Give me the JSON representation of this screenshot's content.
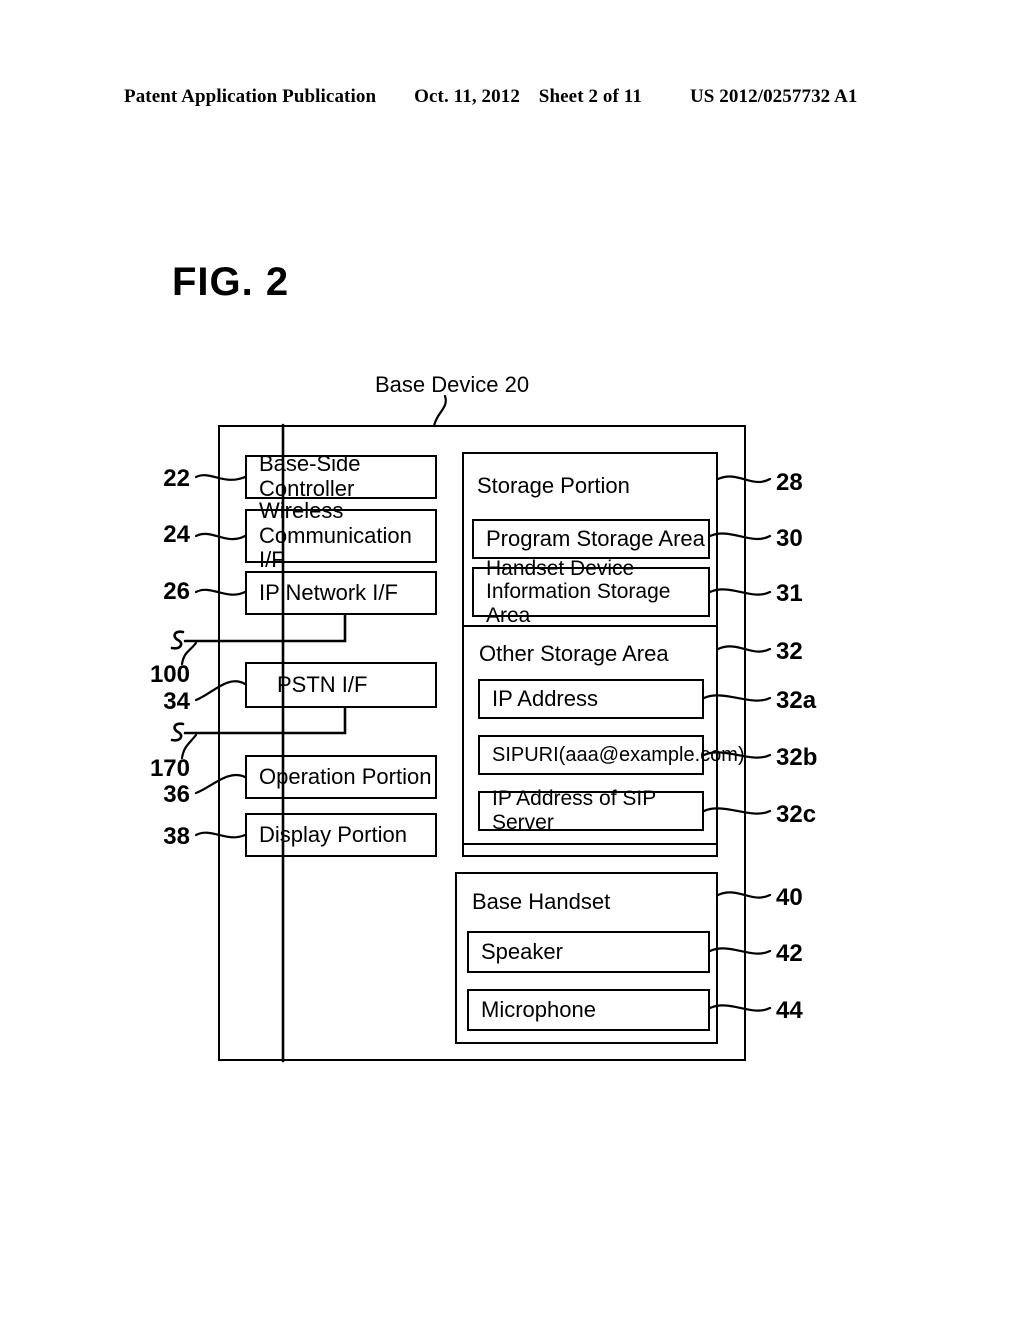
{
  "header": {
    "publication": "Patent Application Publication",
    "date": "Oct. 11, 2012",
    "sheet": "Sheet 2 of 11",
    "patent_number": "US 2012/0257732 A1"
  },
  "figure": {
    "title": "FIG. 2",
    "device_label": "Base Device 20"
  },
  "left_column": {
    "blocks": [
      {
        "ref": "22",
        "label": "Base-Side Controller"
      },
      {
        "ref": "24",
        "label": "Wireless\nCommunication I/F"
      },
      {
        "ref": "26",
        "label": "IP Network I/F"
      },
      {
        "ref": "34",
        "label": "PSTN  I/F"
      },
      {
        "ref": "36",
        "label": "Operation Portion"
      },
      {
        "ref": "38",
        "label": "Display Portion"
      }
    ],
    "external_lines": [
      {
        "ref": "100"
      },
      {
        "ref": "170"
      }
    ]
  },
  "right_column": {
    "storage_portion": {
      "ref": "28",
      "title": "Storage Portion",
      "areas": [
        {
          "ref": "30",
          "label": "Program Storage Area"
        },
        {
          "ref": "31",
          "label": "Handset Device\nInformation Storage Area"
        }
      ],
      "other_storage_area": {
        "ref": "32",
        "title": "Other Storage Area",
        "items": [
          {
            "ref": "32a",
            "label": "IP Address"
          },
          {
            "ref": "32b",
            "label": "SIPURI(aaa@example.com)"
          },
          {
            "ref": "32c",
            "label": "IP Address of SIP Server"
          }
        ]
      }
    },
    "base_handset": {
      "ref": "40",
      "title": "Base Handset",
      "items": [
        {
          "ref": "42",
          "label": "Speaker"
        },
        {
          "ref": "44",
          "label": "Microphone"
        }
      ]
    }
  },
  "colors": {
    "line": "#000000",
    "background": "#ffffff"
  }
}
